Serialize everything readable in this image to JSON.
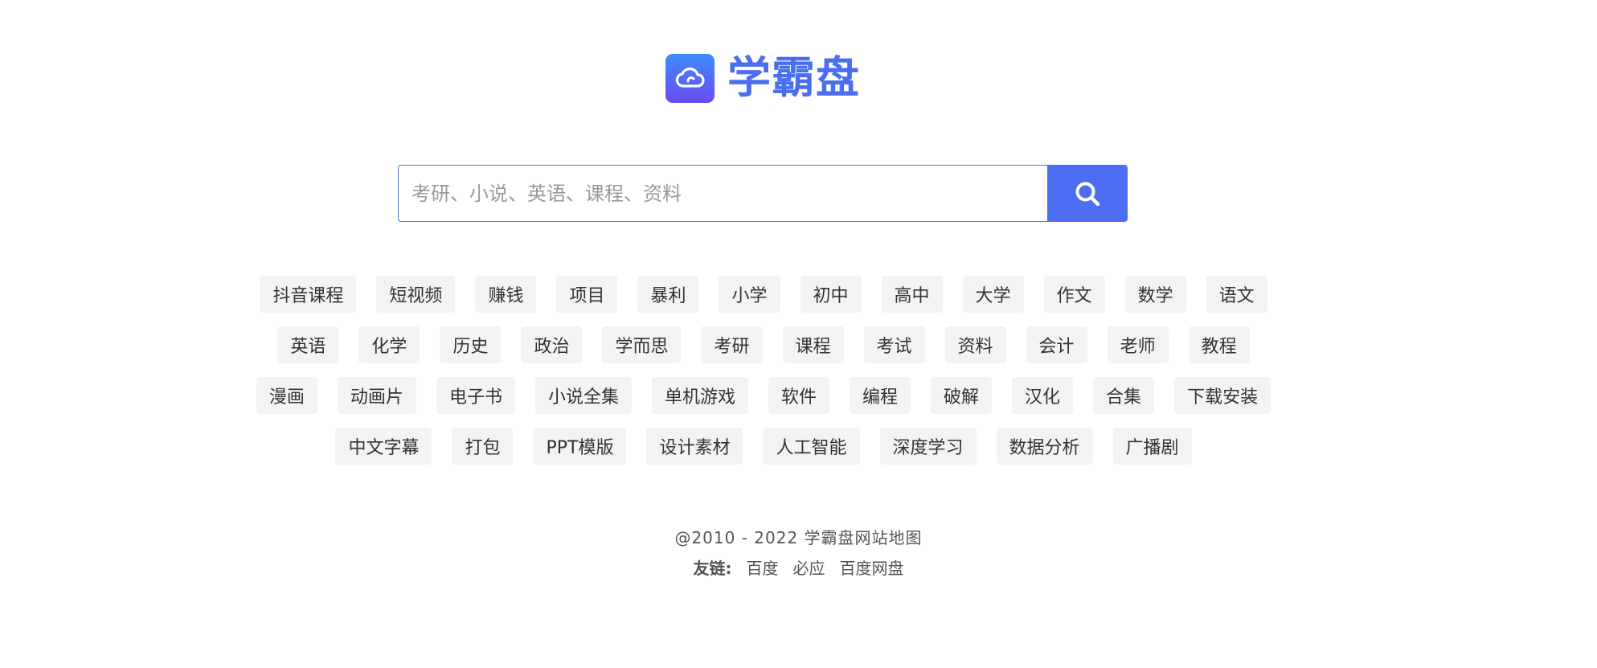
{
  "logo": {
    "text": "学霸盘",
    "icon": "cloud-icon",
    "color": "#4a6ef0"
  },
  "search": {
    "placeholder": "考研、小说、英语、课程、资料",
    "value": "",
    "button_icon": "search-icon",
    "button_color": "#4d6ef3"
  },
  "tags": {
    "rows": [
      [
        "抖音课程",
        "短视频",
        "赚钱",
        "项目",
        "暴利",
        "小学",
        "初中",
        "高中",
        "大学",
        "作文",
        "数学",
        "语文"
      ],
      [
        "英语",
        "化学",
        "历史",
        "政治",
        "学而思",
        "考研",
        "课程",
        "考试",
        "资料",
        "会计",
        "老师",
        "教程"
      ],
      [
        "漫画",
        "动画片",
        "电子书",
        "小说全集",
        "单机游戏",
        "软件",
        "编程",
        "破解",
        "汉化",
        "合集",
        "下载安装"
      ],
      [
        "中文字幕",
        "打包",
        "PPT模版",
        "设计素材",
        "人工智能",
        "深度学习",
        "数据分析",
        "广播剧"
      ]
    ]
  },
  "footer": {
    "copyright": "@2010 - 2022 学霸盘网站地图",
    "friend_label": "友链:",
    "friend_links": [
      "百度",
      "必应",
      "百度网盘"
    ]
  }
}
